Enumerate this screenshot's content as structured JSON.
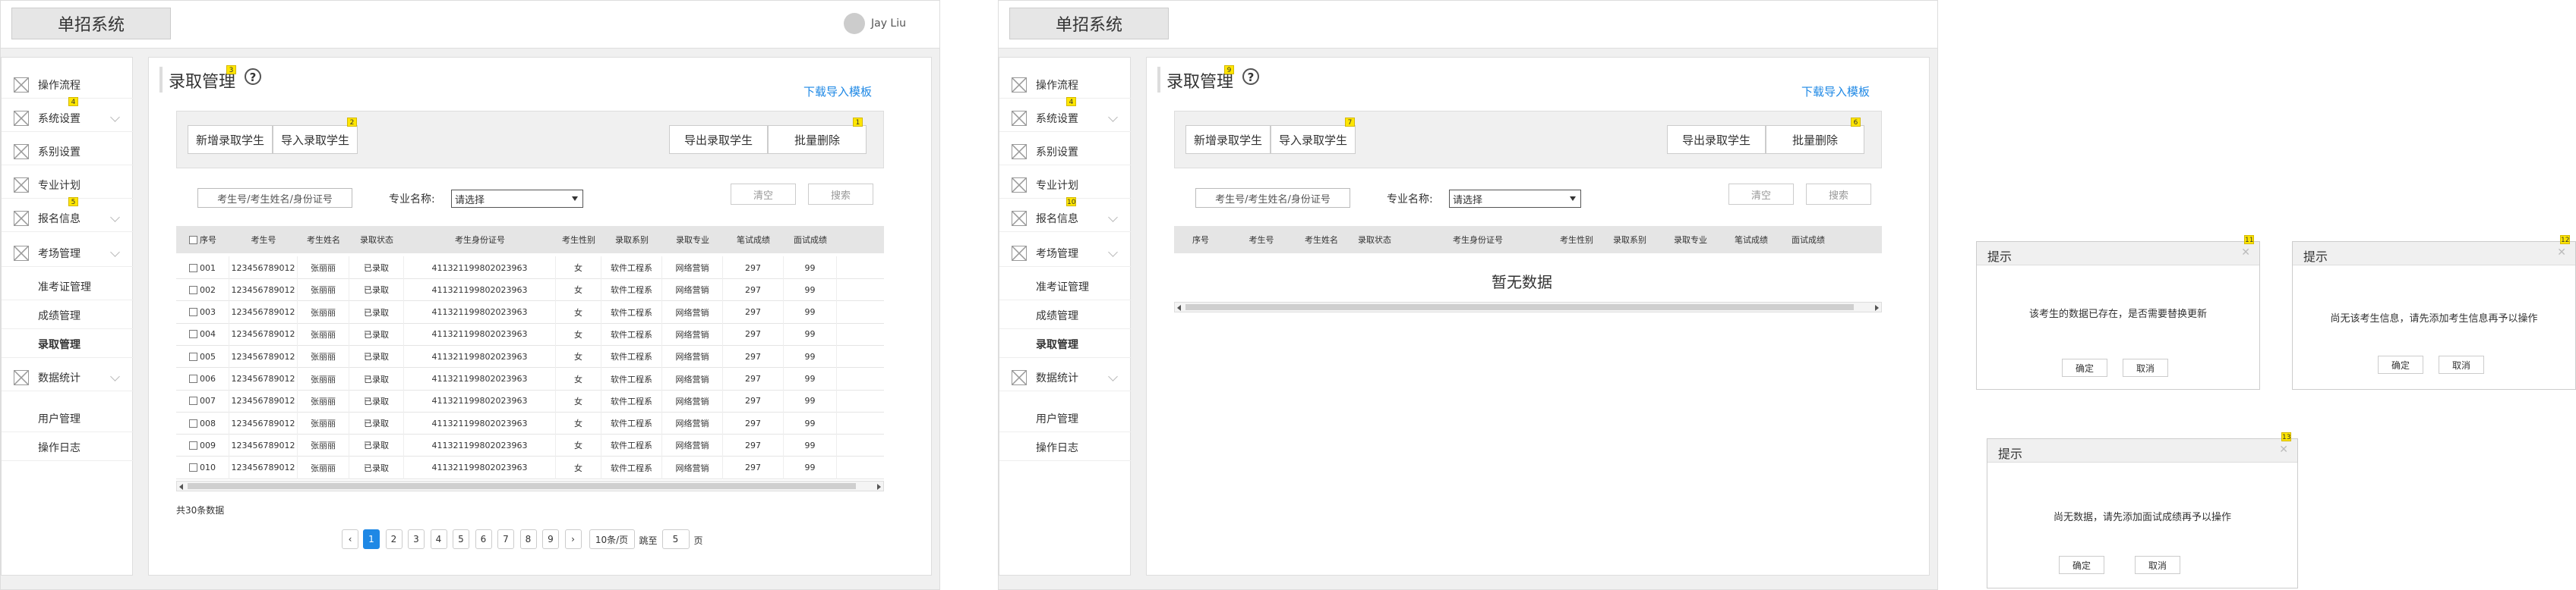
{
  "app": {
    "title": "单招系统",
    "user": "Jay Liu"
  },
  "sidebar": {
    "items": [
      {
        "label": "操作流程",
        "icon": true
      },
      {
        "label": "系统设置",
        "icon": true,
        "chevron": true
      },
      {
        "label": "系别设置",
        "icon": true
      },
      {
        "label": "专业计划",
        "icon": true
      },
      {
        "label": "报名信息",
        "icon": true,
        "chevron": true
      },
      {
        "label": "考场管理",
        "icon": true,
        "chevron": true
      },
      {
        "label": "准考证管理",
        "icon": false
      },
      {
        "label": "成绩管理",
        "icon": false
      },
      {
        "label": "录取管理",
        "icon": false,
        "active": true
      },
      {
        "label": "数据统计",
        "icon": true,
        "chevron": true
      },
      {
        "label": "用户管理",
        "icon": false
      },
      {
        "label": "操作日志",
        "icon": false
      }
    ]
  },
  "page": {
    "title": "录取管理",
    "help": "?",
    "download_link": "下载导入模板",
    "buttons": {
      "add": "新增录取学生",
      "import": "导入录取学生",
      "export": "导出录取学生",
      "batch_delete": "批量删除"
    },
    "search": {
      "placeholder": "考生号/考生姓名/身份证号",
      "major_label": "专业名称:",
      "major_select": "请选择",
      "clear": "清空",
      "search": "搜索"
    }
  },
  "table": {
    "headers": [
      "序号",
      "考生号",
      "考生姓名",
      "录取状态",
      "考生身份证号",
      "考生性别",
      "录取系别",
      "录取专业",
      "笔试成绩",
      "面试成绩"
    ],
    "rows": [
      [
        "001",
        "123456789012",
        "张丽丽",
        "已录取",
        "411321199802023963",
        "女",
        "软件工程系",
        "网络营销",
        "297",
        "99"
      ],
      [
        "002",
        "123456789012",
        "张丽丽",
        "已录取",
        "411321199802023963",
        "女",
        "软件工程系",
        "网络营销",
        "297",
        "99"
      ],
      [
        "003",
        "123456789012",
        "张丽丽",
        "已录取",
        "411321199802023963",
        "女",
        "软件工程系",
        "网络营销",
        "297",
        "99"
      ],
      [
        "004",
        "123456789012",
        "张丽丽",
        "已录取",
        "411321199802023963",
        "女",
        "软件工程系",
        "网络营销",
        "297",
        "99"
      ],
      [
        "005",
        "123456789012",
        "张丽丽",
        "已录取",
        "411321199802023963",
        "女",
        "软件工程系",
        "网络营销",
        "297",
        "99"
      ],
      [
        "006",
        "123456789012",
        "张丽丽",
        "已录取",
        "411321199802023963",
        "女",
        "软件工程系",
        "网络营销",
        "297",
        "99"
      ],
      [
        "007",
        "123456789012",
        "张丽丽",
        "已录取",
        "411321199802023963",
        "女",
        "软件工程系",
        "网络营销",
        "297",
        "99"
      ],
      [
        "008",
        "123456789012",
        "张丽丽",
        "已录取",
        "411321199802023963",
        "女",
        "软件工程系",
        "网络营销",
        "297",
        "99"
      ],
      [
        "009",
        "123456789012",
        "张丽丽",
        "已录取",
        "411321199802023963",
        "女",
        "软件工程系",
        "网络营销",
        "297",
        "99"
      ],
      [
        "010",
        "123456789012",
        "张丽丽",
        "已录取",
        "411321199802023963",
        "女",
        "软件工程系",
        "网络营销",
        "297",
        "99"
      ]
    ],
    "empty_headers": [
      "序号",
      "考生号",
      "考生姓名",
      "录取状态",
      "考生身份证号",
      "考生性别",
      "录取系别",
      "录取专业",
      "笔试成绩",
      "面试成绩"
    ],
    "empty_text": "暂无数据"
  },
  "pagination": {
    "total": "共30条数据",
    "prev": "‹",
    "pages": [
      "1",
      "2",
      "3",
      "4",
      "5",
      "6",
      "7",
      "8",
      "9"
    ],
    "current": "1",
    "next": "›",
    "page_size": "10条/页",
    "jump_label": "跳至",
    "jump_value": "5",
    "page_unit": "页"
  },
  "badges": {
    "help": "3",
    "system": "4",
    "signup_left": "5",
    "import": "2",
    "batch": "1",
    "help_right": "9",
    "signup_right": "10",
    "import_right": "7",
    "batch_right": "6",
    "d1": "11",
    "d2": "12",
    "d3": "13"
  },
  "dialogs": [
    {
      "title": "提示",
      "message": "该考生的数据已存在，是否需要替换更新",
      "ok": "确定",
      "cancel": "取消"
    },
    {
      "title": "提示",
      "message": "尚无该考生信息，请先添加考生信息再予以操作",
      "ok": "确定",
      "cancel": "取消"
    },
    {
      "title": "提示",
      "message": "尚无数据，请先添加面试成绩再予以操作",
      "ok": "确定",
      "cancel": "取消"
    }
  ],
  "colors": {
    "accent": "#1e88e5",
    "badge": "#ffe600"
  }
}
